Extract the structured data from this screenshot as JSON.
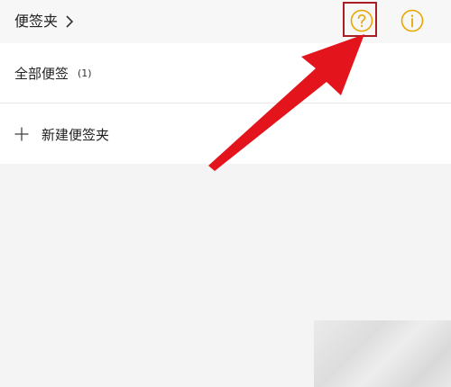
{
  "header": {
    "folder_label": "便签夹",
    "help_icon": "question-circle-icon",
    "info_icon": "info-circle-icon",
    "accent_color": "#e8a600"
  },
  "folders": [
    {
      "label": "全部便签",
      "count": "(1)"
    }
  ],
  "new_folder": {
    "label": "新建便签夹",
    "icon": "plus-icon"
  },
  "annotation": {
    "color": "#e3141b"
  }
}
